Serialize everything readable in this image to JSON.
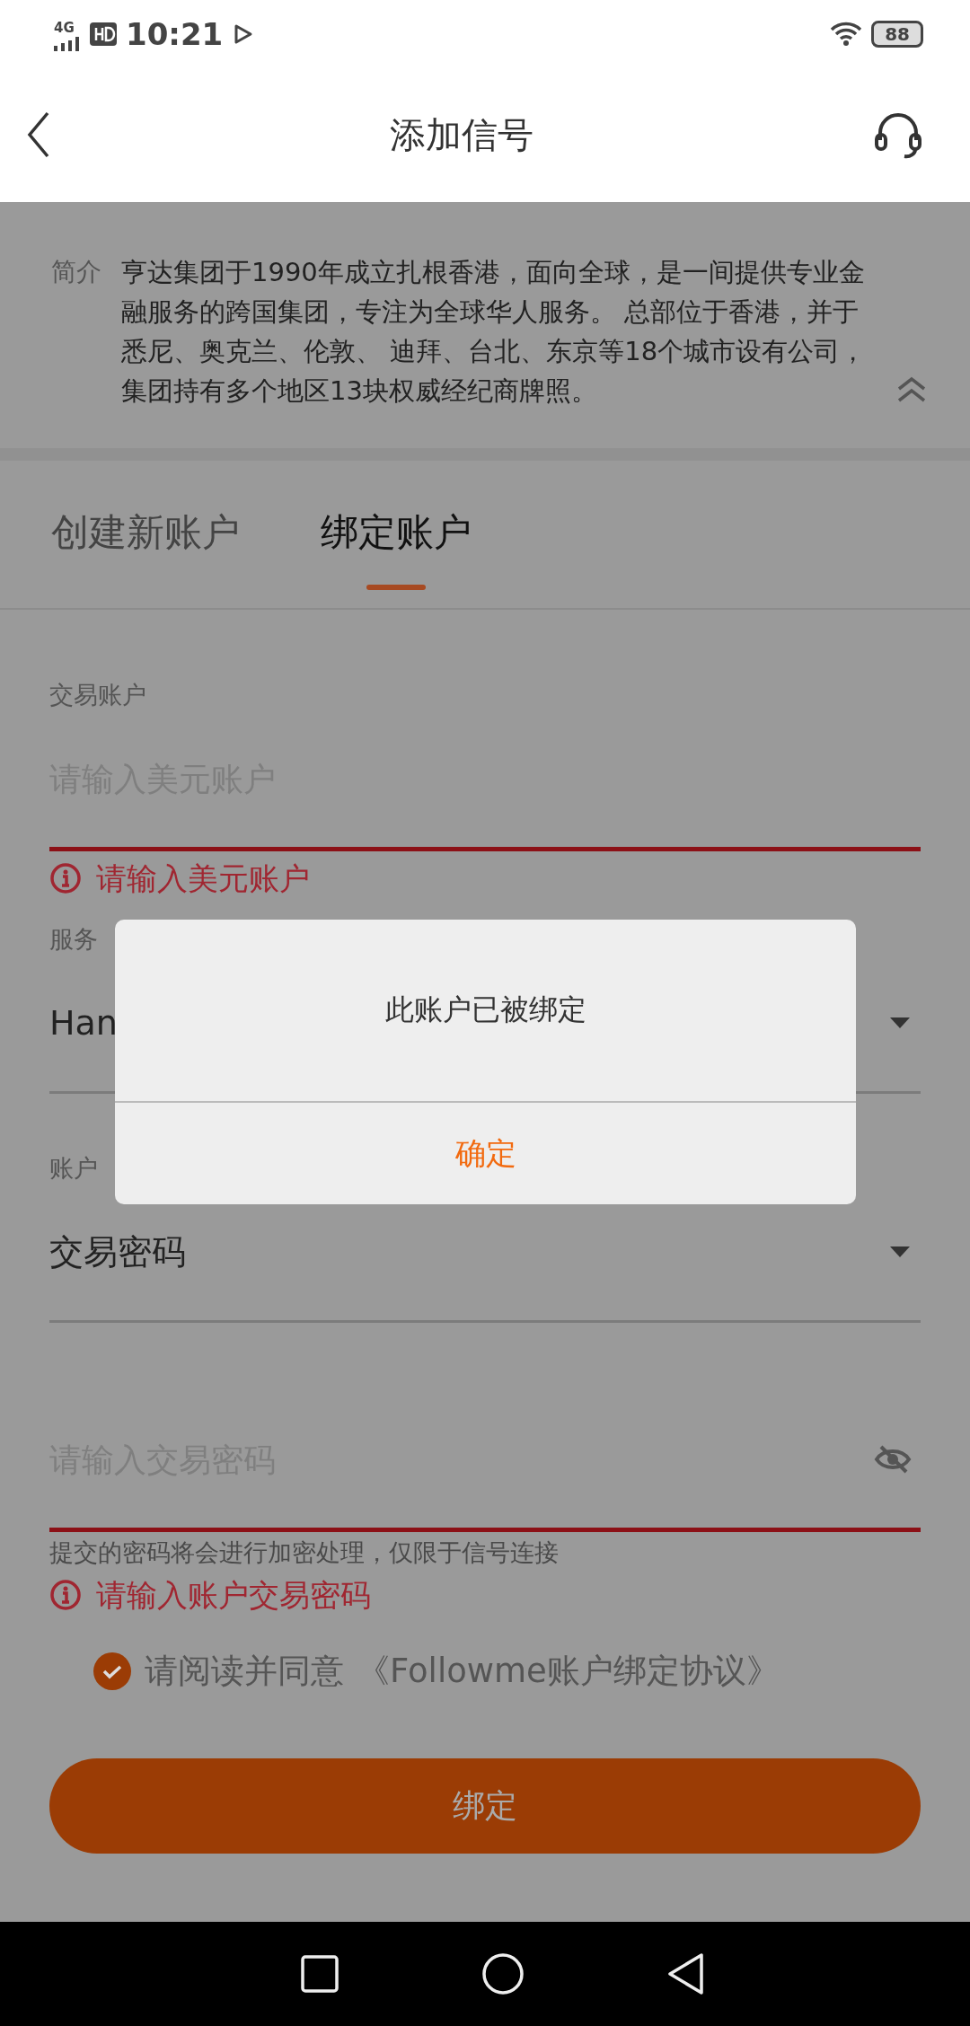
{
  "status_bar": {
    "network": "4G",
    "time": "10:21",
    "battery": "88"
  },
  "header": {
    "title": "添加信号"
  },
  "intro": {
    "label": "简介",
    "text": "亨达集团于1990年成立扎根香港，面向全球，是一间提供专业金融服务的跨国集团，专注为全球华人服务。 总部位于香港，并于悉尼、奥克兰、伦敦、 迪拜、台北、东京等18个城市设有公司，集团持有多个地区13块权威经纪商牌照。"
  },
  "tabs": [
    {
      "label": "创建新账户",
      "selected": false
    },
    {
      "label": "绑定账户",
      "selected": true
    }
  ],
  "fields": [
    {
      "kind": "input",
      "label": "交易账户",
      "placeholder": "请输入美元账户",
      "error": "请输入美元账户"
    },
    {
      "kind": "select",
      "label": "服务",
      "value": "Han"
    },
    {
      "kind": "select",
      "label": "账户",
      "value": "交易密码"
    },
    {
      "kind": "password",
      "placeholder": "请输入交易密码",
      "hint": "提交的密码将会进行加密处理，仅限于信号连接",
      "error": "请输入账户交易密码"
    }
  ],
  "agreement": {
    "checked": true,
    "text": "请阅读并同意",
    "link": "《Followme账户绑定协议》"
  },
  "submit": "绑定",
  "dialog": {
    "message": "此账户已被绑定",
    "confirm": "确定"
  }
}
